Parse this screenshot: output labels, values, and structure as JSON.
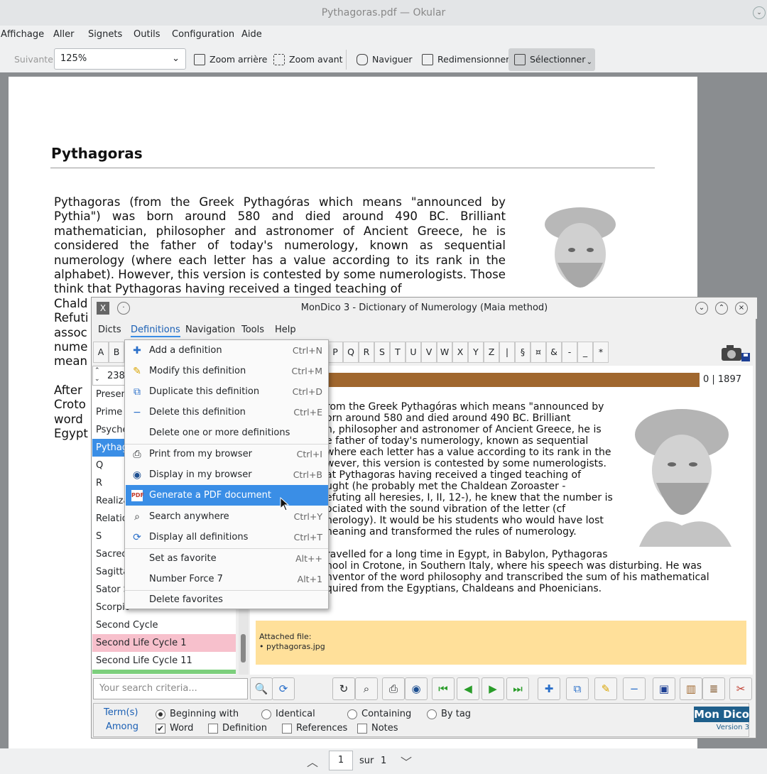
{
  "okular": {
    "title": "Pythagoras.pdf — Okular",
    "menu": [
      "Affichage",
      "Aller",
      "Signets",
      "Outils",
      "Configuration",
      "Aide"
    ],
    "toolbar": {
      "next": "Suivante",
      "zoom": "125%",
      "zoom_out": "Zoom arrière",
      "zoom_in": "Zoom avant",
      "browse": "Naviguer",
      "resize": "Redimensionner",
      "select": "Sélectionner"
    },
    "page": {
      "title": "Pythagoras",
      "para": "Pythagoras (from the Greek Pythagóras which means \"announced by Pythia\") was born around 580 and died around 490 BC. Brilliant mathematician, philosopher and astronomer of Ancient Greece, he is considered the father of today's numerology, known as sequential numerology (where each letter has a value according to its rank in the alphabet). However, this version is contested by some numerologists. Those think that Pythagoras having received a tinged teaching of",
      "cut_lines": [
        "Chald",
        "Refuti",
        "assoc",
        "nume",
        "mean"
      ],
      "para2_lines": [
        "After",
        "Croto",
        "word",
        "Egypt"
      ]
    },
    "pager": {
      "current": "1",
      "of_label": "sur",
      "total": "1"
    }
  },
  "mondico": {
    "title": "MonDico 3 - Dictionary of Numerology (Maia method)",
    "menu": [
      "Dicts",
      "Definitions",
      "Navigation",
      "Tools",
      "Help"
    ],
    "letters_left": [
      "A",
      "B"
    ],
    "letters_right": [
      "P",
      "Q",
      "R",
      "S",
      "T",
      "U",
      "V",
      "W",
      "X",
      "Y",
      "Z",
      "|",
      "§",
      "¤",
      "&",
      "-",
      "_",
      "*"
    ],
    "counter": "238",
    "progress_label": "0 | 1897",
    "list": [
      {
        "label": "Presen",
        "state": "normal"
      },
      {
        "label": "Prime N",
        "state": "normal"
      },
      {
        "label": "Psyche",
        "state": "normal"
      },
      {
        "label": "Pythag",
        "state": "selected"
      },
      {
        "label": "Q",
        "state": "normal"
      },
      {
        "label": "R",
        "state": "normal"
      },
      {
        "label": "Realiza",
        "state": "normal"
      },
      {
        "label": "Relatio",
        "state": "normal"
      },
      {
        "label": "S",
        "state": "normal"
      },
      {
        "label": "Sacred",
        "state": "normal"
      },
      {
        "label": "Sagitta",
        "state": "normal"
      },
      {
        "label": "Sator S",
        "state": "normal"
      },
      {
        "label": "Scorpio",
        "state": "normal"
      },
      {
        "label": "Second Cycle",
        "state": "normal"
      },
      {
        "label": "Second Life Cycle 1",
        "state": "pink"
      },
      {
        "label": "Second Life Cycle 11",
        "state": "normal"
      }
    ],
    "definition_lines": [
      "rom the Greek Pythagóras which means \"announced by",
      "orn around 580 and died around 490 BC. Brilliant",
      "n, philosopher and astronomer of Ancient Greece, he is",
      "e father of today's numerology, known as sequential",
      "where each letter has a value according to its rank in the",
      "wever, this version is contested by some numerologists.",
      "at Pythagoras having received a tinged teaching of",
      "ught (he probably met the Chaldean Zoroaster -",
      "efuting all heresies, I, II, 12-), he knew that the number is",
      "ociated with the sound vibration of the letter (cf",
      "nerology). It would be his students who would have lost",
      "neaning and transformed the rules of numerology."
    ],
    "definition_lines2": [
      "ravelled for a long time in Egypt, in Babylon, Pythagoras",
      "hool in Crotone, in Southern Italy, where his speech was disturbing. He was",
      "nventor of the word philosophy and transcribed the sum of his mathematical",
      "quired from the Egyptians, Chaldeans and Phoenicians."
    ],
    "attached_label": "Attached file:",
    "attached_file": "• pythagoras.jpg",
    "search_placeholder": "Your search criteria...",
    "options": {
      "term_label": "Term(s)",
      "among_label": "Among",
      "begin": "Beginning with",
      "identical": "Identical",
      "containing": "Containing",
      "by_tag": "By tag",
      "word": "Word",
      "definition": "Definition",
      "references": "References",
      "notes": "Notes"
    },
    "logo_text": "Mon Dico",
    "version": "Version 3"
  },
  "definitions_menu": [
    {
      "label": "Add a definition",
      "shortcut": "Ctrl+N",
      "icon": "plus-icon"
    },
    {
      "label": "Modify this definition",
      "shortcut": "Ctrl+M",
      "icon": "pencil-icon"
    },
    {
      "label": "Duplicate this definition",
      "shortcut": "Ctrl+D",
      "icon": "duplicate-icon"
    },
    {
      "label": "Delete this definition",
      "shortcut": "Ctrl+E",
      "icon": "minus-icon"
    },
    {
      "label": "Delete one or more definitions",
      "shortcut": "",
      "icon": ""
    },
    {
      "label": "Print from my browser",
      "shortcut": "Ctrl+I",
      "icon": "printer-icon"
    },
    {
      "label": "Display in my browser",
      "shortcut": "Ctrl+B",
      "icon": "globe-icon"
    },
    {
      "label": "Generate a PDF document",
      "shortcut": "",
      "icon": "pdf-icon"
    },
    {
      "label": "Search anywhere",
      "shortcut": "Ctrl+Y",
      "icon": "magnifier-icon"
    },
    {
      "label": "Display all definitions",
      "shortcut": "Ctrl+T",
      "icon": "refresh-icon"
    },
    {
      "label": "Set as favorite",
      "shortcut": "Alt++",
      "icon": ""
    },
    {
      "label": "Number Force 7",
      "shortcut": "Alt+1",
      "icon": ""
    },
    {
      "label": "Delete favorites",
      "shortcut": "",
      "icon": ""
    }
  ],
  "colors": {
    "accent": "#3a8ee6",
    "progress": "#a0672e",
    "attach_bg": "#ffe09a",
    "pink_row": "#f7c0cc",
    "logo": "#1f5f8b"
  }
}
